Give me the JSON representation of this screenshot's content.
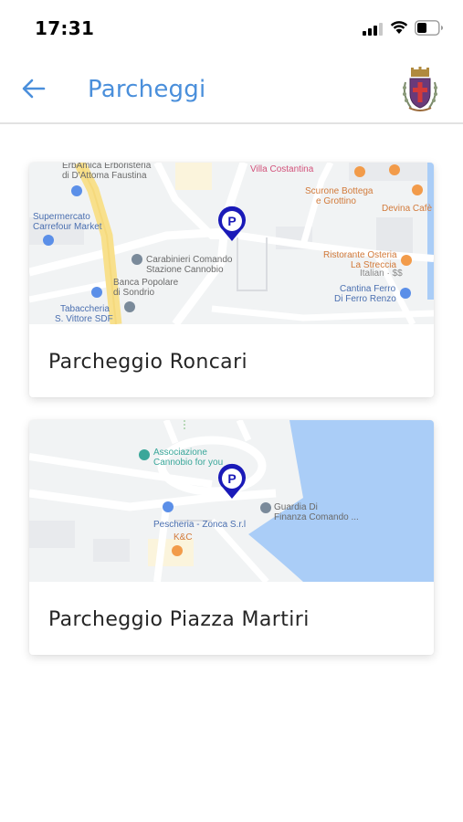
{
  "status_bar": {
    "time": "17:31",
    "icons": [
      "cellular-signal-icon",
      "wifi-icon",
      "battery-icon"
    ]
  },
  "header": {
    "title": "Parcheggi",
    "back_icon": "arrow-left-icon",
    "logo": "municipal-crest-icon",
    "accent_color": "#4a8fdb"
  },
  "parkings": [
    {
      "name": "Parcheggio Roncari",
      "map_labels": {
        "erbamica": "ErbAmica Erboristeria",
        "attoma": "di D'Attoma Faustina",
        "villa": "Villa Costantina",
        "scurone": "Scurone Bottega",
        "grottino": "e Grottino",
        "devina": "Devina Cafè",
        "supermercato": "Supermercato",
        "carrefour": "Carrefour Market",
        "carabinieri": "Carabinieri Comando",
        "stazione": "Stazione Cannobio",
        "osteria": "Ristorante Osteria",
        "strecia": "La Streccia",
        "italian": "Italian · $$",
        "banca": "Banca Popolare",
        "sondrio": "di Sondrio",
        "cantina": "Cantina Ferro",
        "ferro_renzo": "Di Ferro Renzo",
        "tabaccheria": "Tabaccheria",
        "vittore": "S. Vittore SDF"
      }
    },
    {
      "name": "Parcheggio Piazza Martiri",
      "map_labels": {
        "associazione": "Associazione",
        "cannobio_you": "Cannobio for you",
        "guardia": "Guardia Di",
        "finanza": "Finanza Comando ...",
        "pescheria": "Pescheria - Zonca S.r.l",
        "kc": "K&C"
      }
    }
  ],
  "colors": {
    "parking_pin": "#1a1ab8",
    "map_water": "#aacdf7",
    "map_land": "#f1f3f4",
    "poi_orange": "#f29b4a",
    "poi_blue": "#5b8fe8",
    "poi_teal": "#3aa79a"
  }
}
